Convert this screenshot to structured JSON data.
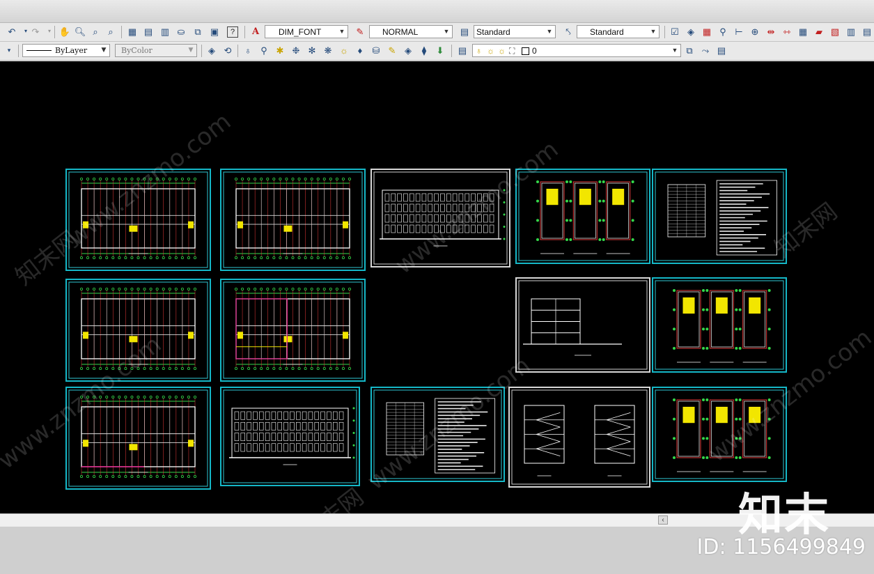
{
  "toolbar": {
    "row1": {
      "text_style": "DIM_FONT",
      "dim_style": "NORMAL",
      "table_style": "Standard",
      "multileader_style": "Standard"
    },
    "row2": {
      "linetype": "ByLayer",
      "color": "ByColor",
      "layer": "0"
    }
  },
  "icons": {
    "row1": [
      "undo-icon",
      "redo-icon",
      "pan-icon",
      "zoom-realtime-icon",
      "zoom-window-icon",
      "zoom-previous-icon",
      "properties-icon",
      "design-center-icon",
      "tool-palettes-icon",
      "markup-icon",
      "sheet-set-icon",
      "quickcalc-icon",
      "help-icon",
      "text-style-icon",
      "dim-style-icon",
      "table-style-icon",
      "mleader-style-icon"
    ],
    "row2": [
      "layer-properties-icon",
      "layer-previous-icon",
      "lightbulb-icon",
      "layer-isolate-icon",
      "layer-off-icon",
      "layer-freeze-icon",
      "layer-lock-icon",
      "layer-match-icon",
      "layer-walk-icon",
      "layer-merge-icon",
      "layer-delete-icon",
      "layer-state-icon",
      "layer-toggle-icon",
      "make-current-icon"
    ]
  },
  "watermarks": {
    "site": "www.znzmo.com",
    "cn": "知末网",
    "logo": "知末",
    "id": "ID: 1156499849"
  },
  "colors": {
    "canvas": "#000000",
    "sheet_border": "#15b8c8",
    "plan_red": "#e23a3a",
    "plan_green": "#34d84a",
    "plan_yellow": "#f2e600",
    "plan_magenta": "#e0208a"
  },
  "drawing_sheets": [
    {
      "id": "floor-plan-1",
      "type": "floor-plan"
    },
    {
      "id": "floor-plan-2",
      "type": "floor-plan"
    },
    {
      "id": "elevation-front",
      "type": "elevation"
    },
    {
      "id": "stair-details-1",
      "type": "detail"
    },
    {
      "id": "design-notes-1",
      "type": "table"
    },
    {
      "id": "floor-plan-3",
      "type": "floor-plan"
    },
    {
      "id": "roof-plan",
      "type": "floor-plan"
    },
    {
      "id": "section-1",
      "type": "section"
    },
    {
      "id": "stair-details-2",
      "type": "detail"
    },
    {
      "id": "floor-plan-4",
      "type": "floor-plan"
    },
    {
      "id": "elevation-side",
      "type": "elevation"
    },
    {
      "id": "design-notes-2",
      "type": "table"
    },
    {
      "id": "section-2",
      "type": "section"
    },
    {
      "id": "stair-details-3",
      "type": "detail"
    }
  ]
}
